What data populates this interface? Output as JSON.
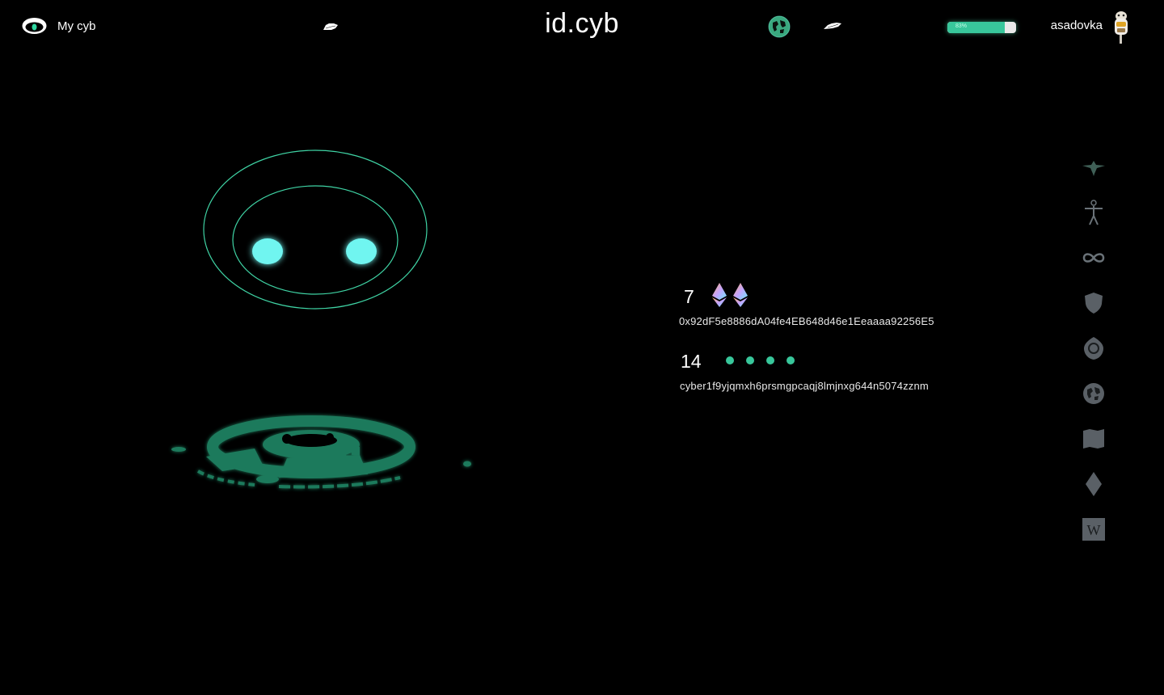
{
  "header": {
    "my_cyb_label": "My cyb",
    "title": "id.cyb",
    "battery_percent": 83,
    "battery_label": "83%",
    "username": "asadovka"
  },
  "accounts": [
    {
      "count": "7",
      "icon": "ethereum-icon",
      "address": "0x92dF5e8886dA04fe4EB648d46e1Eeaaaa92256E5"
    },
    {
      "count": "14",
      "icon": "cyber-dots-icon",
      "address": "cyber1f9yjqmxh6prsmgpcaqj8lmjnxg644n5074zznm"
    }
  ],
  "sidebar": {
    "items": [
      {
        "icon": "bird-icon"
      },
      {
        "icon": "human-figure-icon"
      },
      {
        "icon": "infinity-icon"
      },
      {
        "icon": "shield-icon"
      },
      {
        "icon": "ring-icon"
      },
      {
        "icon": "globe-icon"
      },
      {
        "icon": "map-icon"
      },
      {
        "icon": "diamond-icon"
      },
      {
        "icon": "wikipedia-icon"
      }
    ]
  },
  "colors": {
    "background": "#000000",
    "accent": "#38c79b",
    "accent_glow": "#6ff5f0",
    "robot_outline": "#3fd3a4",
    "platform": "#1f7a5c",
    "icon_gray": "#5a6066"
  }
}
